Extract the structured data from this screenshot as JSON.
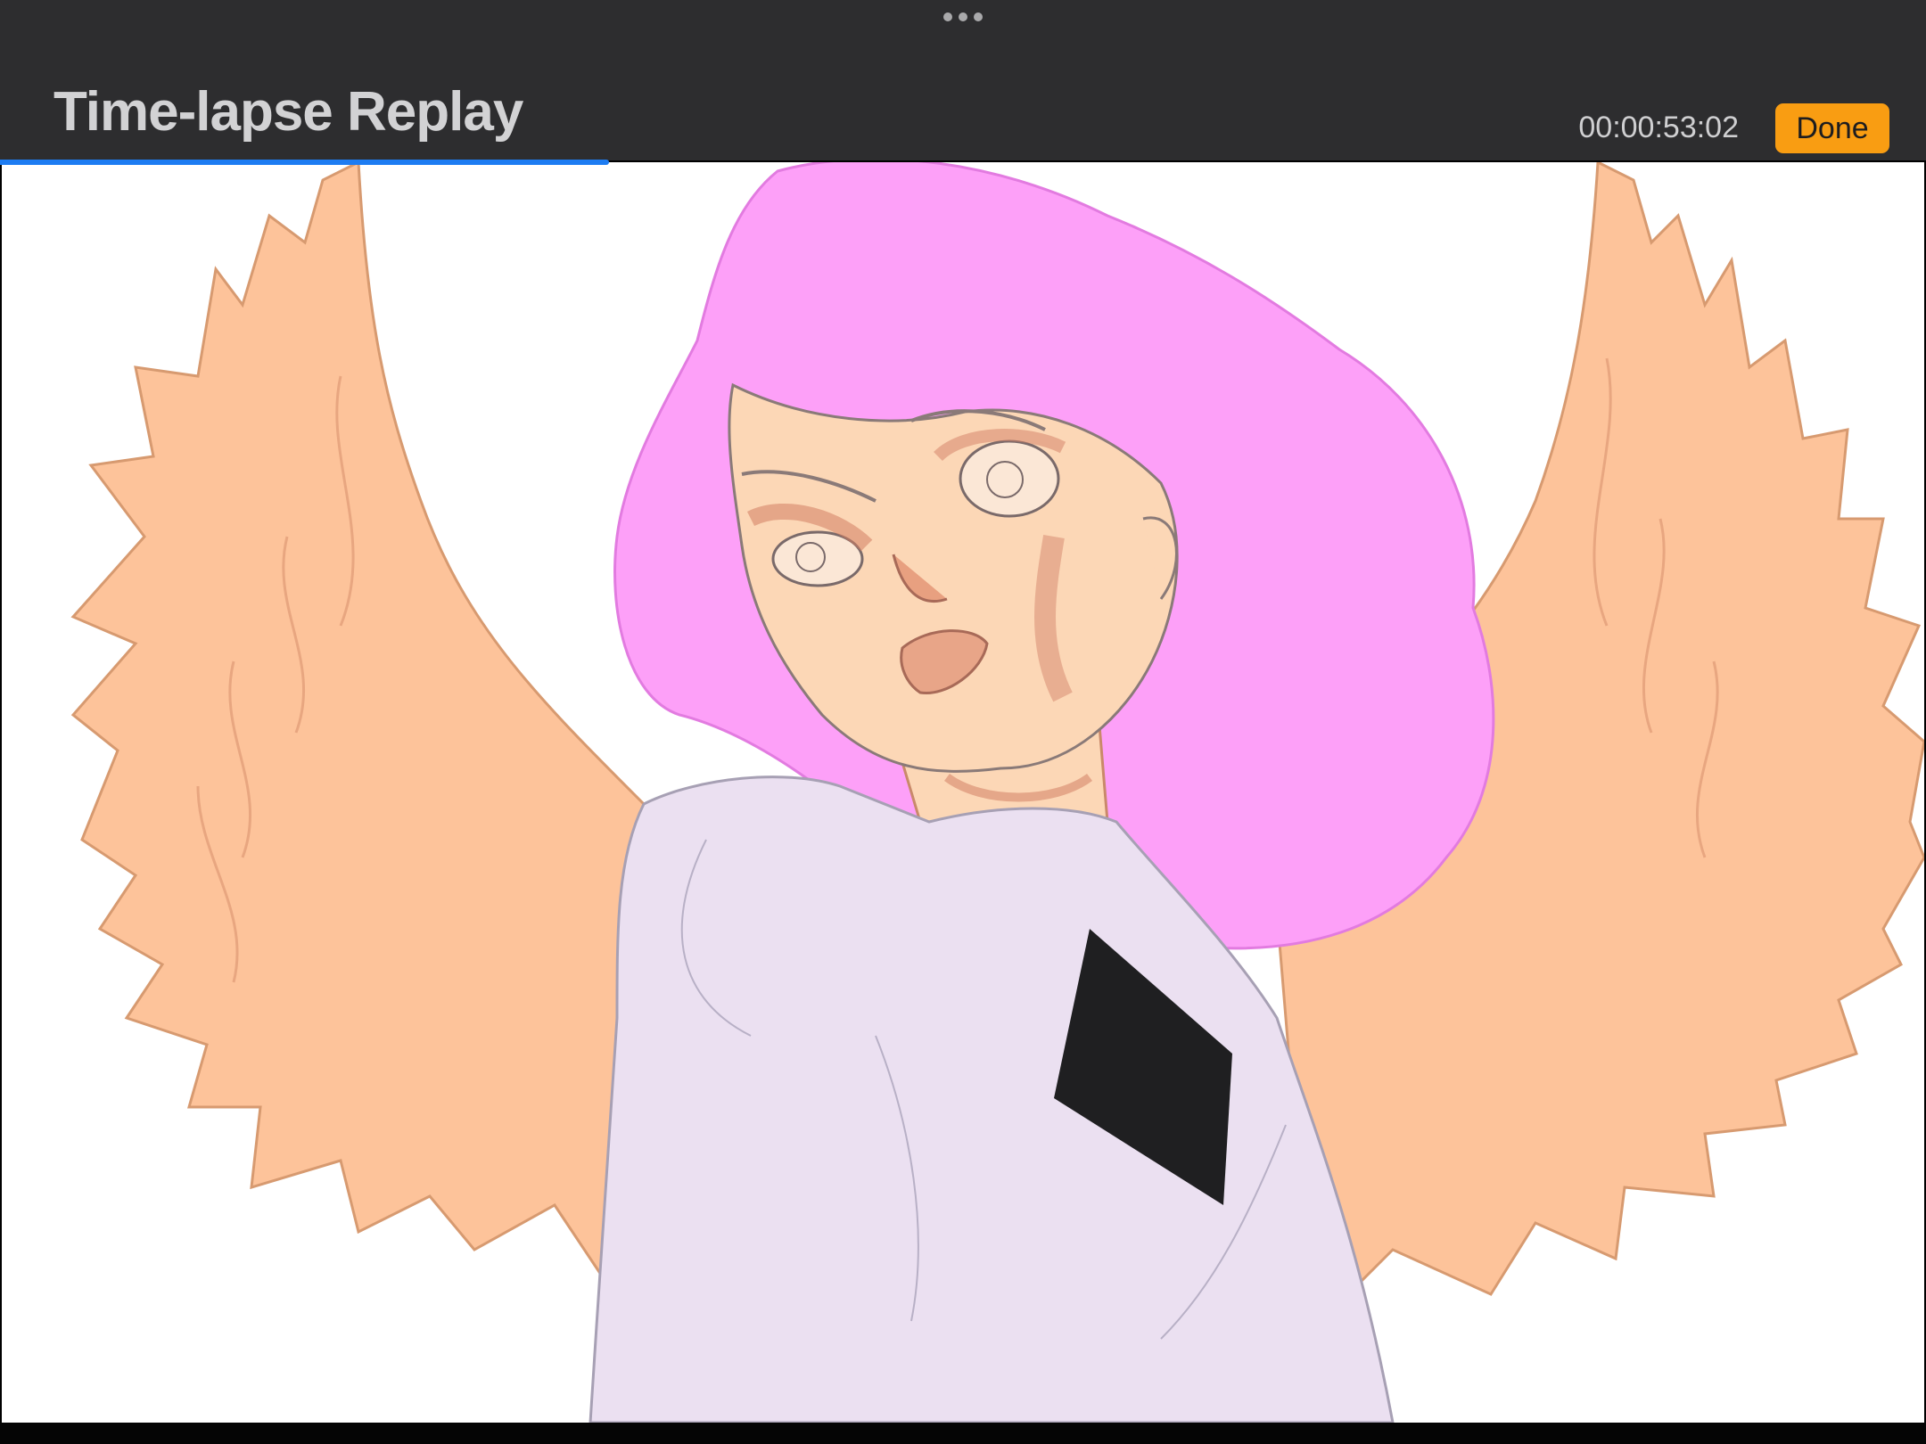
{
  "header": {
    "title": "Time-lapse Replay",
    "timer": "00:00:53:02",
    "done_label": "Done"
  },
  "playback": {
    "progress_fraction": 0.316
  },
  "icons": {
    "grabber": "more-dots-icon"
  },
  "colors": {
    "accent_done": "#f99d12",
    "progress": "#1d7cf2",
    "header_bg": "#2d2d2f"
  }
}
